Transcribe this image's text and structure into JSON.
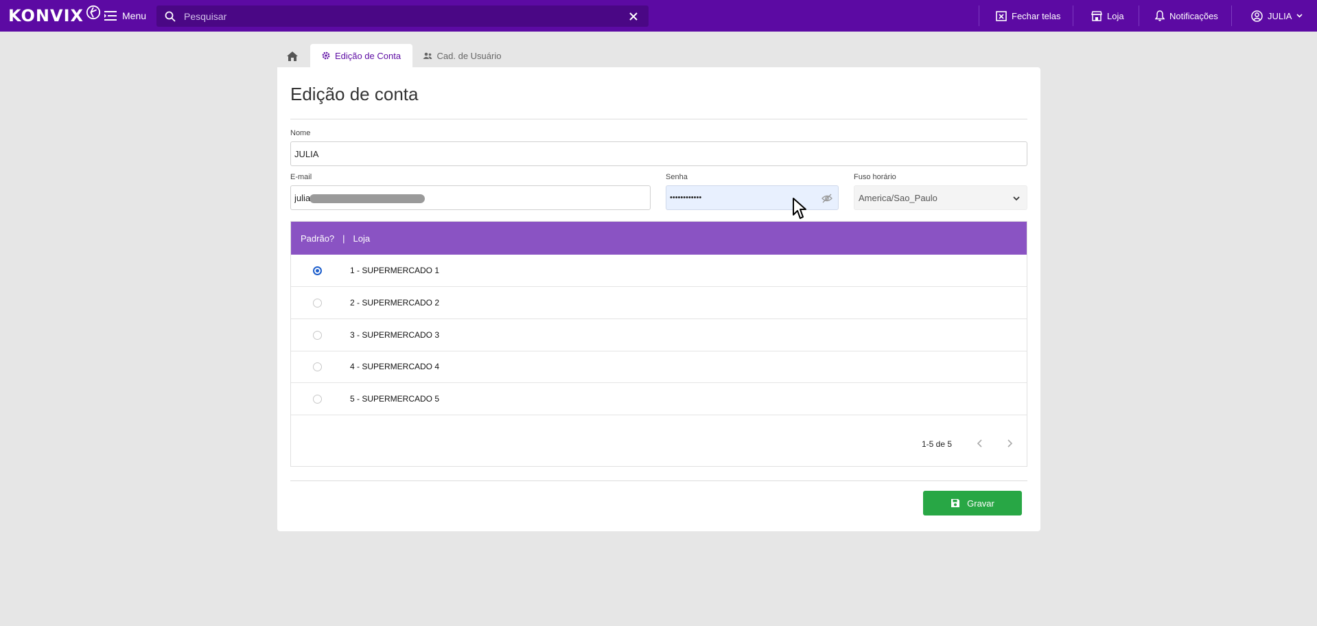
{
  "app": {
    "brand": "Konvix",
    "logo_text": "KONVIX"
  },
  "topbar": {
    "menu_label": "Menu",
    "search_placeholder": "Pesquisar",
    "close_screens_label": "Fechar telas",
    "store_label": "Loja",
    "notifications_label": "Notificações",
    "user_label": "JULIA"
  },
  "tabs": [
    {
      "label": "Home",
      "icon": "home-icon"
    },
    {
      "label": "Edição de Conta",
      "icon": "gear-icon",
      "active": true
    },
    {
      "label": "Cad. de Usuário",
      "icon": "users-icon"
    }
  ],
  "form": {
    "title": "Edição de conta",
    "nome_label": "Nome",
    "nome_value": "JULIA",
    "email_label": "E-mail",
    "email_value": "julia",
    "senha_label": "Senha",
    "senha_value": "••••••••••••",
    "fuso_label": "Fuso horário",
    "fuso_value": "America/Sao_Paulo"
  },
  "table": {
    "col_default": "Padrão?",
    "col_separator": "|",
    "col_store": "Loja",
    "rows": [
      {
        "label": "1 - SUPERMERCADO 1",
        "selected": true
      },
      {
        "label": "2 - SUPERMERCADO 2",
        "selected": false
      },
      {
        "label": "3 - SUPERMERCADO 3",
        "selected": false
      },
      {
        "label": "4 - SUPERMERCADO 4",
        "selected": false
      },
      {
        "label": "5 - SUPERMERCADO 5",
        "selected": false
      }
    ],
    "pagination": "1-5 de 5"
  },
  "actions": {
    "save_label": "Gravar"
  },
  "colors": {
    "topbar": "#5c0aa3",
    "table_header": "#8a53c3",
    "save_button": "#28a745",
    "radio_selected": "#1e5fcc"
  }
}
